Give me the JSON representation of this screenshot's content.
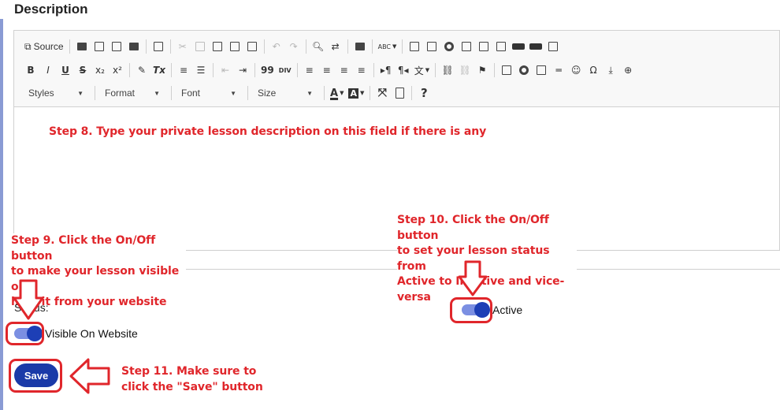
{
  "section": {
    "title": "Description"
  },
  "toolbar": {
    "row1": [
      {
        "icon": "source-icon",
        "label": "Source"
      },
      {
        "sep": true
      },
      {
        "icon": "save-icon"
      },
      {
        "icon": "new-page-icon"
      },
      {
        "icon": "preview-icon"
      },
      {
        "icon": "print-icon"
      },
      {
        "sep": true
      },
      {
        "icon": "templates-icon"
      },
      {
        "sep": true
      },
      {
        "icon": "cut-icon",
        "dim": true
      },
      {
        "icon": "copy-icon",
        "dim": true
      },
      {
        "icon": "paste-icon"
      },
      {
        "icon": "paste-text-icon"
      },
      {
        "icon": "paste-word-icon"
      },
      {
        "sep": true
      },
      {
        "icon": "undo-icon",
        "dim": true
      },
      {
        "icon": "redo-icon",
        "dim": true
      },
      {
        "sep": true
      },
      {
        "icon": "find-icon"
      },
      {
        "icon": "replace-icon"
      },
      {
        "sep": true
      },
      {
        "icon": "select-all-icon"
      },
      {
        "sep": true
      },
      {
        "icon": "spellcheck-icon",
        "caret": true
      },
      {
        "sep": true
      },
      {
        "icon": "form-icon"
      },
      {
        "icon": "checkbox-icon"
      },
      {
        "icon": "radio-icon"
      },
      {
        "icon": "textfield-icon"
      },
      {
        "icon": "textarea-icon"
      },
      {
        "icon": "select-field-icon"
      },
      {
        "icon": "button-field-icon"
      },
      {
        "icon": "image-button-icon"
      },
      {
        "icon": "hidden-field-icon"
      }
    ],
    "row2": [
      {
        "icon": "bold-icon",
        "glyph": "B"
      },
      {
        "icon": "italic-icon",
        "glyph": "I"
      },
      {
        "icon": "underline-icon",
        "glyph": "U"
      },
      {
        "icon": "strike-icon",
        "glyph": "S"
      },
      {
        "icon": "subscript-icon",
        "glyph": "x₂"
      },
      {
        "icon": "superscript-icon",
        "glyph": "x²"
      },
      {
        "sep": true
      },
      {
        "icon": "copy-format-icon"
      },
      {
        "icon": "remove-format-icon",
        "glyph": "Tx"
      },
      {
        "sep": true
      },
      {
        "icon": "numbered-list-icon"
      },
      {
        "icon": "bulleted-list-icon"
      },
      {
        "sep": true
      },
      {
        "icon": "outdent-icon",
        "dim": true
      },
      {
        "icon": "indent-icon"
      },
      {
        "sep": true
      },
      {
        "icon": "blockquote-icon",
        "glyph": "99"
      },
      {
        "icon": "div-icon",
        "glyph": "DIV"
      },
      {
        "sep": true
      },
      {
        "icon": "align-left-icon"
      },
      {
        "icon": "align-center-icon"
      },
      {
        "icon": "align-right-icon"
      },
      {
        "icon": "justify-icon"
      },
      {
        "sep": true
      },
      {
        "icon": "ltr-icon",
        "glyph": "▸¶"
      },
      {
        "icon": "rtl-icon",
        "glyph": "¶◂"
      },
      {
        "icon": "language-icon",
        "caret": true
      },
      {
        "sep": true
      },
      {
        "icon": "link-icon"
      },
      {
        "icon": "unlink-icon",
        "dim": true
      },
      {
        "icon": "anchor-flag-icon"
      },
      {
        "sep": true
      },
      {
        "icon": "image-icon"
      },
      {
        "icon": "flash-icon"
      },
      {
        "icon": "table-icon"
      },
      {
        "icon": "horizontal-rule-icon"
      },
      {
        "icon": "smiley-icon",
        "glyph": "☺"
      },
      {
        "icon": "special-char-icon",
        "glyph": "Ω"
      },
      {
        "icon": "page-break-icon"
      },
      {
        "icon": "iframe-globe-icon",
        "glyph": "⊕"
      }
    ],
    "row3": {
      "combos": [
        "Styles",
        "Format",
        "Font",
        "Size"
      ],
      "text_color_icon": "text-color-icon",
      "bg_color_icon": "background-color-icon",
      "maximize_icon": "maximize-icon",
      "show_blocks_icon": "show-blocks-icon",
      "help_icon": "help-icon"
    }
  },
  "annotations": {
    "step8": "Step 8. Type your private lesson description on this field if there is any",
    "step9": [
      "Step 9. Click the On/Off button",
      "to make your lesson visible or",
      "hide it from your website"
    ],
    "step10": [
      "Step 10. Click the On/Off button",
      "to set your lesson status from",
      "Active to Inactive and vice-versa"
    ],
    "step11": [
      "Step 11. Make sure to",
      "click the \"Save\" button"
    ]
  },
  "form": {
    "status_label": "Status:",
    "visible_toggle": {
      "label": "Visible On Website",
      "on": true
    },
    "active_toggle": {
      "label": "Active",
      "on": true
    },
    "save_label": "Save"
  },
  "colors": {
    "annotation_red": "#e0262b",
    "toggle_track": "#7b8fe2",
    "toggle_knob": "#1d3fb6",
    "save_button": "#1a3aa8"
  }
}
